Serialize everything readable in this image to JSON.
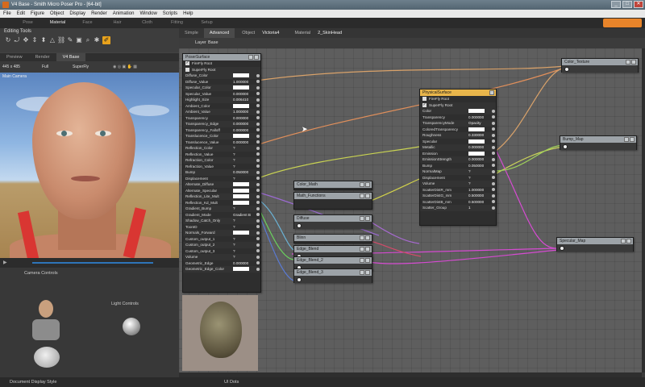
{
  "window": {
    "title": "V4 Base - Smith Micro Poser Pro - [64-bit]",
    "buttons": [
      "_",
      "□",
      "✕"
    ]
  },
  "menu": [
    "File",
    "Edit",
    "Figure",
    "Object",
    "Display",
    "Render",
    "Animation",
    "Window",
    "Scripts",
    "Help"
  ],
  "rooms": [
    "Pose",
    "Material",
    "Face",
    "Hair",
    "Cloth",
    "Fitting",
    "Setup"
  ],
  "active_room": "Material",
  "editing_tools": {
    "label": "Editing Tools",
    "icons": [
      "rotate-icon",
      "twist-icon",
      "translate-icon",
      "scale-icon",
      "taper-icon",
      "chain-break-icon",
      "color-icon",
      "grouping-icon",
      "view-magnifier-icon",
      "morph-brush-icon",
      "direct-manipulation-icon",
      "eyedropper-icon"
    ]
  },
  "view_tabs": [
    "Preview",
    "Render",
    "V4 Base"
  ],
  "viewport_bar": {
    "size": "445 x 485",
    "shading": "Full",
    "renderer": "SuperFly"
  },
  "viewport_label": "Main Camera",
  "camera_controls": "Camera Controls",
  "light_controls": "Light Controls",
  "status": {
    "left": "Document Display Style",
    "center": "UI Dots"
  },
  "mat_tabs": [
    "Simple",
    "Advanced"
  ],
  "mat_selectors": {
    "object_label": "Object",
    "object": "Victoria4",
    "material_label": "Material",
    "material": "2_SkinHead"
  },
  "layer": {
    "label": "Layer",
    "value": "Base"
  },
  "poser_surface": {
    "title": "PoserSurface",
    "flags": [
      "FireFly Root",
      "SuperFly Root"
    ],
    "rows": [
      {
        "name": "Diffuse_Color",
        "val": ""
      },
      {
        "name": "Diffuse_Value",
        "val": "1.000000"
      },
      {
        "name": "Specular_Color",
        "val": ""
      },
      {
        "name": "Specular_Value",
        "val": "0.000000"
      },
      {
        "name": "Highlight_Size",
        "val": "0.006410"
      },
      {
        "name": "Ambient_Color",
        "val": ""
      },
      {
        "name": "Ambient_Value",
        "val": "1.000000"
      },
      {
        "name": "Transparency",
        "val": "0.000000"
      },
      {
        "name": "Transparency_Edge",
        "val": "0.000000"
      },
      {
        "name": "Transparency_Falloff",
        "val": "0.000000"
      },
      {
        "name": "Translucence_Color",
        "val": ""
      },
      {
        "name": "Translucence_Value",
        "val": "0.000000"
      },
      {
        "name": "Reflection_Color",
        "val": "?"
      },
      {
        "name": "Reflection_Value",
        "val": "?"
      },
      {
        "name": "Refraction_Color",
        "val": "?"
      },
      {
        "name": "Refraction_Value",
        "val": "?"
      },
      {
        "name": "Bump",
        "val": "0.050000"
      },
      {
        "name": "Displacement",
        "val": "?"
      },
      {
        "name": "Alternate_Diffuse",
        "val": ""
      },
      {
        "name": "Alternate_Specular",
        "val": ""
      },
      {
        "name": "Reflection_Lite_Mult",
        "val": ""
      },
      {
        "name": "Reflection_Kd_Mult",
        "val": ""
      },
      {
        "name": "Gradient_Bump",
        "val": "?"
      },
      {
        "name": "Gradient_Mode",
        "val": "Gradient B"
      },
      {
        "name": "Shadow_Catch_Only",
        "val": "?"
      },
      {
        "name": "ToonID",
        "val": "?"
      },
      {
        "name": "Normals_Forward",
        "val": ""
      },
      {
        "name": "Custom_output_1",
        "val": "?"
      },
      {
        "name": "Custom_output_2",
        "val": "?"
      },
      {
        "name": "Custom_output_3",
        "val": "?"
      },
      {
        "name": "Volume",
        "val": "?"
      },
      {
        "name": "Geometric_Edge",
        "val": "0.000000"
      },
      {
        "name": "Geometric_Edge_Color",
        "val": ""
      }
    ]
  },
  "physical_surface": {
    "title": "PhysicalSurface",
    "flags": [
      "FireFly Root",
      "SuperFly Root"
    ],
    "rows": [
      {
        "name": "Color",
        "val": ""
      },
      {
        "name": "Transparency",
        "val": "0.000000"
      },
      {
        "name": "TransparencyMode",
        "val": "Opacity"
      },
      {
        "name": "ColoredTransparency",
        "val": ""
      },
      {
        "name": "Roughness",
        "val": "0.330000"
      },
      {
        "name": "Specular",
        "val": ""
      },
      {
        "name": "Metallic",
        "val": "0.000000"
      },
      {
        "name": "Emission",
        "val": ""
      },
      {
        "name": "EmissionStrength",
        "val": "0.000000"
      },
      {
        "name": "Bump",
        "val": "0.050000"
      },
      {
        "name": "NormalMap",
        "val": "?"
      },
      {
        "name": "Displacement",
        "val": "?"
      },
      {
        "name": "Volume",
        "val": "?"
      },
      {
        "name": "ScatterDistR_mm",
        "val": "1.000000"
      },
      {
        "name": "ScatterDistG_mm",
        "val": "0.500000"
      },
      {
        "name": "ScatterDistB_mm",
        "val": "0.500000"
      },
      {
        "name": "Scatter_Group",
        "val": "1"
      }
    ]
  },
  "small_nodes": [
    "Color_Math",
    "Math_Functions",
    "Diffuse",
    "Blinn",
    "Edge_Blend",
    "Edge_Blend_2",
    "Edge_Blend_3"
  ],
  "texture_nodes": [
    "Color_Texture",
    "Bump_Map",
    "Specular_Map"
  ],
  "colors": {
    "accent": "#e8842a",
    "selected_node": "#e9b64b",
    "node_header": "#9da3a8",
    "graph_bg": "#5e5e5e"
  }
}
